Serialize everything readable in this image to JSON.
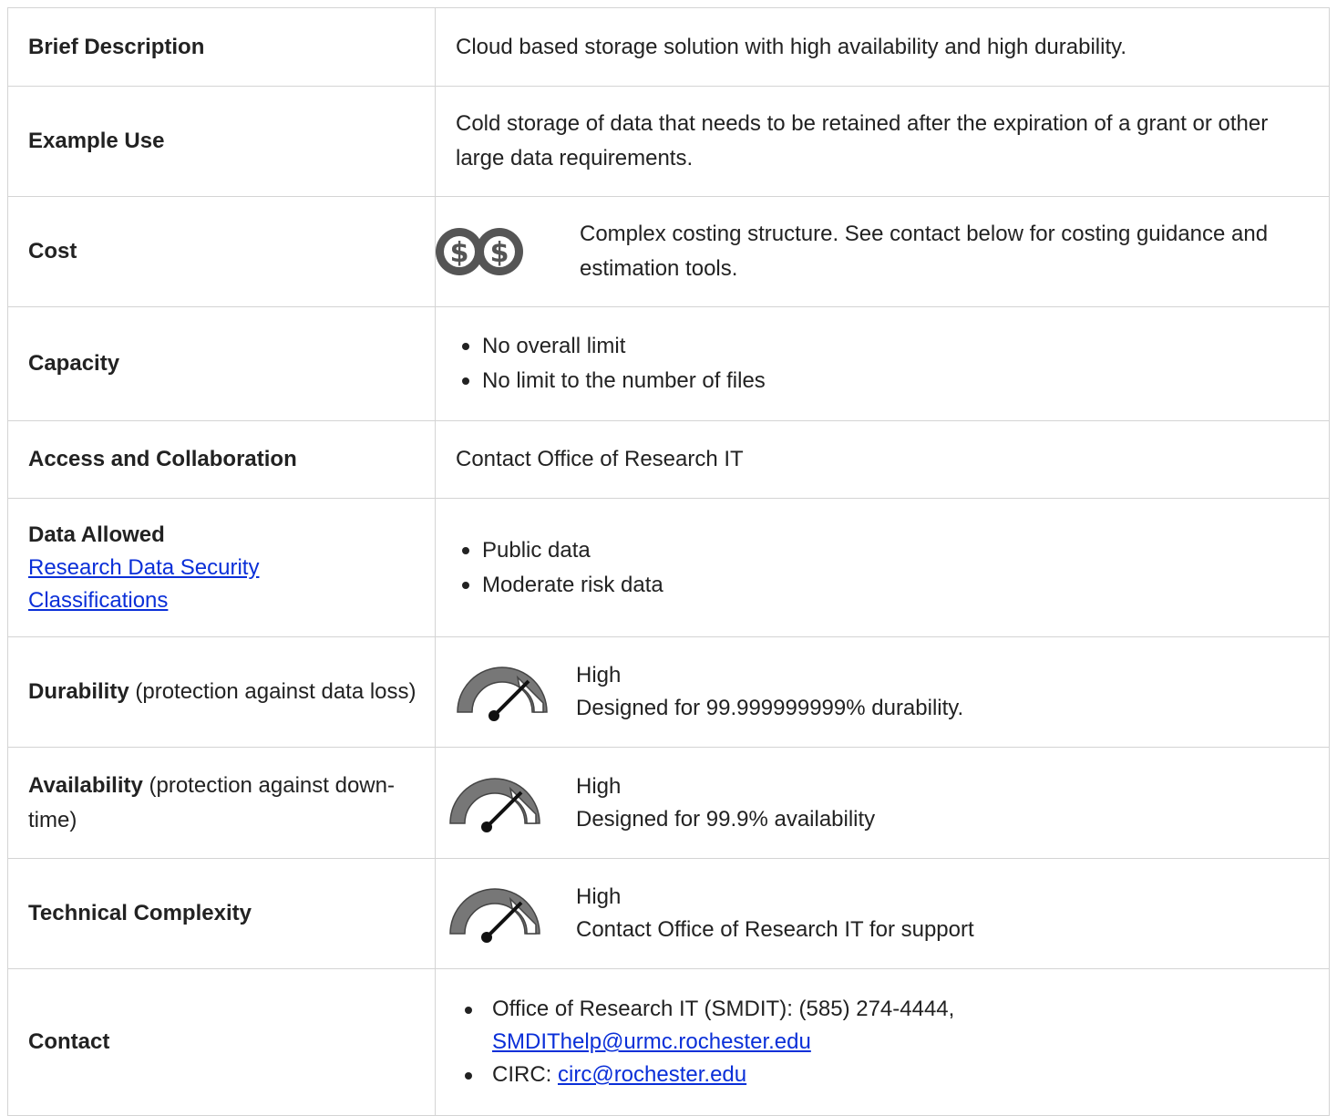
{
  "rows": {
    "brief": {
      "label": "Brief Description",
      "value": "Cloud based storage solution with high availability and high durability."
    },
    "example": {
      "label": "Example Use",
      "value": "Cold storage of data that needs to be retained after the expiration of a grant or other large data requirements."
    },
    "cost": {
      "label": "Cost",
      "icon": "double-dollar-icon",
      "value": "Complex costing structure. See contact below for costing guidance and estimation tools."
    },
    "capacity": {
      "label": "Capacity",
      "items": [
        "No overall limit",
        "No limit to the number of files"
      ]
    },
    "access": {
      "label": "Access and Collaboration",
      "value": "Contact Office of Research IT"
    },
    "data_allowed": {
      "label": "Data Allowed",
      "link": "Research Data Security Classifications",
      "items": [
        "Public data",
        "Moderate risk data"
      ]
    },
    "durability": {
      "label": "Durability",
      "sublabel": " (protection against data loss)",
      "icon": "gauge-high-icon",
      "level": "High",
      "detail": "Designed for 99.999999999% durability."
    },
    "availability": {
      "label": "Availability",
      "sublabel": " (protection against down-time)",
      "icon": "gauge-high-icon",
      "level": "High",
      "detail": "Designed for 99.9% availability"
    },
    "complexity": {
      "label": "Technical Complexity",
      "icon": "gauge-high-icon",
      "level": "High",
      "detail": "Contact Office of Research IT for support"
    },
    "contact": {
      "label": "Contact",
      "item1_text": "Office of Research IT (SMDIT): (585) 274-4444,",
      "item1_link": "SMDIThelp@urmc.rochester.edu",
      "item2_text": "CIRC: ",
      "item2_link": "circ@rochester.edu"
    }
  },
  "colors": {
    "link": "#0a2fd8",
    "border": "#d4d4d4",
    "icon": "#555555"
  }
}
